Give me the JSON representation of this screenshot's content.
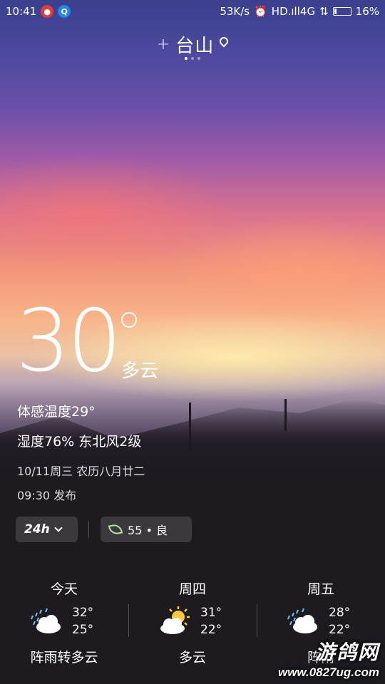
{
  "status_bar": {
    "time": "10:41",
    "speed": "53K/s",
    "network": "HD.ıll4G",
    "battery": "16%",
    "battery_level": 0.16
  },
  "header": {
    "add_symbol": "+",
    "city": "台山"
  },
  "current": {
    "temp": "30",
    "condition": "多云",
    "feels_like": "体感温度29°",
    "humidity_wind": "湿度76% 东北风2级",
    "date_line": "10/11周三  农历八月廿二",
    "publish": "09:30 发布"
  },
  "controls": {
    "hourly_label": "24h",
    "aqi_label": "55 • 良"
  },
  "forecast": [
    {
      "day": "今天",
      "icon": "rain-cloud-icon",
      "hi": "32°",
      "lo": "25°",
      "desc": "阵雨转多云"
    },
    {
      "day": "周四",
      "icon": "sun-cloud-icon",
      "hi": "31°",
      "lo": "22°",
      "desc": "多云"
    },
    {
      "day": "周五",
      "icon": "rain-cloud-icon",
      "hi": "28°",
      "lo": "22°",
      "desc": "阵雨"
    }
  ],
  "watermark": {
    "title": "游鸽网",
    "url": "www.0827ug.com"
  }
}
